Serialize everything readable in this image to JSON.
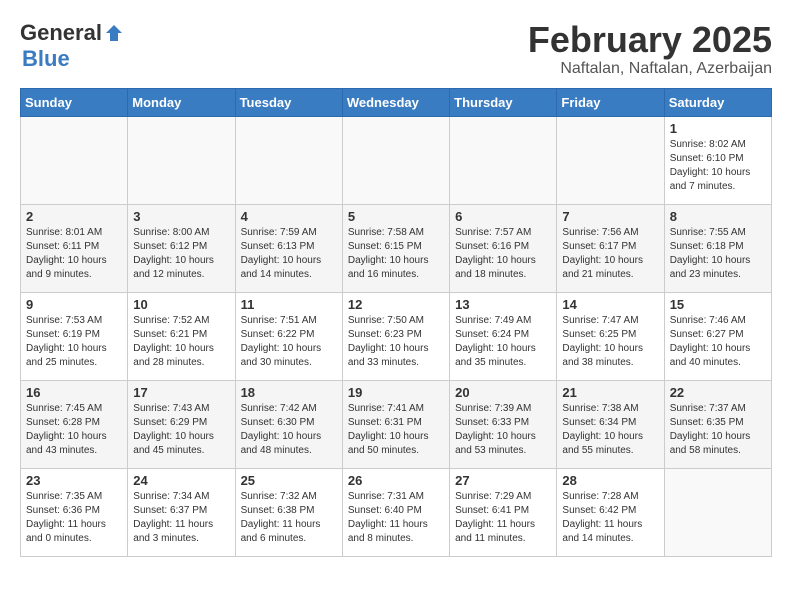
{
  "header": {
    "logo_general": "General",
    "logo_blue": "Blue",
    "month": "February 2025",
    "location": "Naftalan, Naftalan, Azerbaijan"
  },
  "days_of_week": [
    "Sunday",
    "Monday",
    "Tuesday",
    "Wednesday",
    "Thursday",
    "Friday",
    "Saturday"
  ],
  "weeks": [
    [
      {
        "day": "",
        "info": ""
      },
      {
        "day": "",
        "info": ""
      },
      {
        "day": "",
        "info": ""
      },
      {
        "day": "",
        "info": ""
      },
      {
        "day": "",
        "info": ""
      },
      {
        "day": "",
        "info": ""
      },
      {
        "day": "1",
        "info": "Sunrise: 8:02 AM\nSunset: 6:10 PM\nDaylight: 10 hours\nand 7 minutes."
      }
    ],
    [
      {
        "day": "2",
        "info": "Sunrise: 8:01 AM\nSunset: 6:11 PM\nDaylight: 10 hours\nand 9 minutes."
      },
      {
        "day": "3",
        "info": "Sunrise: 8:00 AM\nSunset: 6:12 PM\nDaylight: 10 hours\nand 12 minutes."
      },
      {
        "day": "4",
        "info": "Sunrise: 7:59 AM\nSunset: 6:13 PM\nDaylight: 10 hours\nand 14 minutes."
      },
      {
        "day": "5",
        "info": "Sunrise: 7:58 AM\nSunset: 6:15 PM\nDaylight: 10 hours\nand 16 minutes."
      },
      {
        "day": "6",
        "info": "Sunrise: 7:57 AM\nSunset: 6:16 PM\nDaylight: 10 hours\nand 18 minutes."
      },
      {
        "day": "7",
        "info": "Sunrise: 7:56 AM\nSunset: 6:17 PM\nDaylight: 10 hours\nand 21 minutes."
      },
      {
        "day": "8",
        "info": "Sunrise: 7:55 AM\nSunset: 6:18 PM\nDaylight: 10 hours\nand 23 minutes."
      }
    ],
    [
      {
        "day": "9",
        "info": "Sunrise: 7:53 AM\nSunset: 6:19 PM\nDaylight: 10 hours\nand 25 minutes."
      },
      {
        "day": "10",
        "info": "Sunrise: 7:52 AM\nSunset: 6:21 PM\nDaylight: 10 hours\nand 28 minutes."
      },
      {
        "day": "11",
        "info": "Sunrise: 7:51 AM\nSunset: 6:22 PM\nDaylight: 10 hours\nand 30 minutes."
      },
      {
        "day": "12",
        "info": "Sunrise: 7:50 AM\nSunset: 6:23 PM\nDaylight: 10 hours\nand 33 minutes."
      },
      {
        "day": "13",
        "info": "Sunrise: 7:49 AM\nSunset: 6:24 PM\nDaylight: 10 hours\nand 35 minutes."
      },
      {
        "day": "14",
        "info": "Sunrise: 7:47 AM\nSunset: 6:25 PM\nDaylight: 10 hours\nand 38 minutes."
      },
      {
        "day": "15",
        "info": "Sunrise: 7:46 AM\nSunset: 6:27 PM\nDaylight: 10 hours\nand 40 minutes."
      }
    ],
    [
      {
        "day": "16",
        "info": "Sunrise: 7:45 AM\nSunset: 6:28 PM\nDaylight: 10 hours\nand 43 minutes."
      },
      {
        "day": "17",
        "info": "Sunrise: 7:43 AM\nSunset: 6:29 PM\nDaylight: 10 hours\nand 45 minutes."
      },
      {
        "day": "18",
        "info": "Sunrise: 7:42 AM\nSunset: 6:30 PM\nDaylight: 10 hours\nand 48 minutes."
      },
      {
        "day": "19",
        "info": "Sunrise: 7:41 AM\nSunset: 6:31 PM\nDaylight: 10 hours\nand 50 minutes."
      },
      {
        "day": "20",
        "info": "Sunrise: 7:39 AM\nSunset: 6:33 PM\nDaylight: 10 hours\nand 53 minutes."
      },
      {
        "day": "21",
        "info": "Sunrise: 7:38 AM\nSunset: 6:34 PM\nDaylight: 10 hours\nand 55 minutes."
      },
      {
        "day": "22",
        "info": "Sunrise: 7:37 AM\nSunset: 6:35 PM\nDaylight: 10 hours\nand 58 minutes."
      }
    ],
    [
      {
        "day": "23",
        "info": "Sunrise: 7:35 AM\nSunset: 6:36 PM\nDaylight: 11 hours\nand 0 minutes."
      },
      {
        "day": "24",
        "info": "Sunrise: 7:34 AM\nSunset: 6:37 PM\nDaylight: 11 hours\nand 3 minutes."
      },
      {
        "day": "25",
        "info": "Sunrise: 7:32 AM\nSunset: 6:38 PM\nDaylight: 11 hours\nand 6 minutes."
      },
      {
        "day": "26",
        "info": "Sunrise: 7:31 AM\nSunset: 6:40 PM\nDaylight: 11 hours\nand 8 minutes."
      },
      {
        "day": "27",
        "info": "Sunrise: 7:29 AM\nSunset: 6:41 PM\nDaylight: 11 hours\nand 11 minutes."
      },
      {
        "day": "28",
        "info": "Sunrise: 7:28 AM\nSunset: 6:42 PM\nDaylight: 11 hours\nand 14 minutes."
      },
      {
        "day": "",
        "info": ""
      }
    ]
  ]
}
